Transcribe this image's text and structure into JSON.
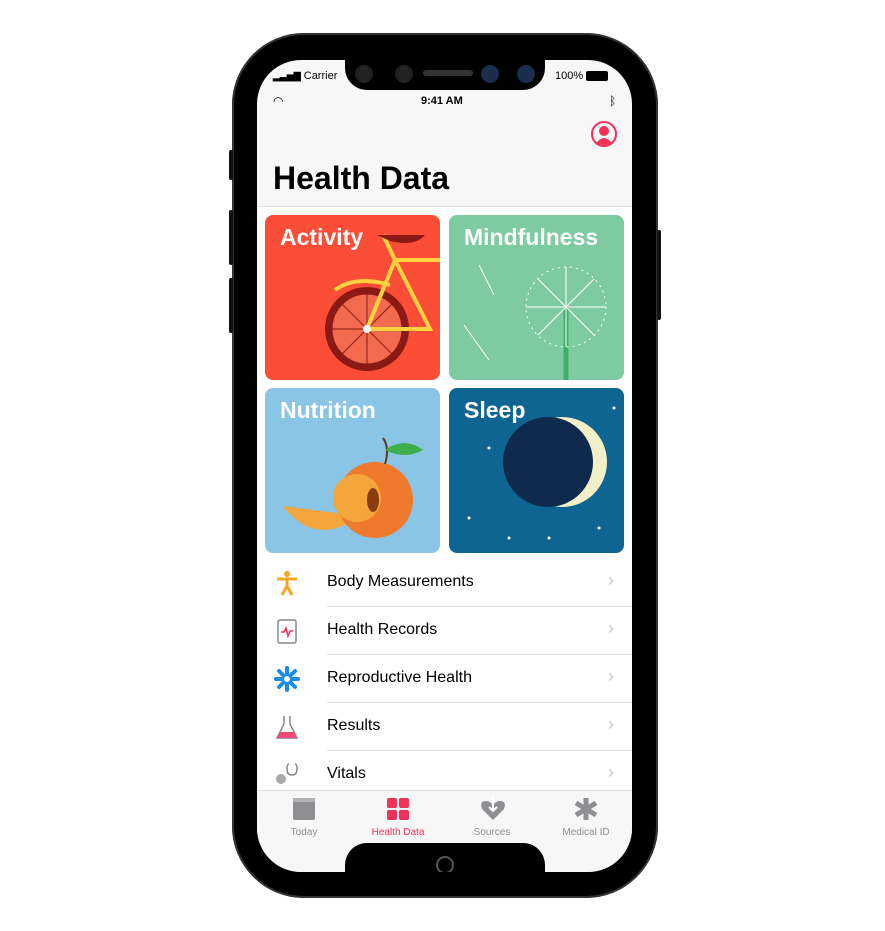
{
  "status_bar": {
    "carrier": "Carrier",
    "time": "9:41 AM",
    "battery": "100%"
  },
  "header": {
    "title": "Health Data",
    "profile_icon": "person-circle-icon"
  },
  "tiles": [
    {
      "label": "Activity",
      "color": "#fc4e37"
    },
    {
      "label": "Mindfulness",
      "color": "#7ecba1"
    },
    {
      "label": "Nutrition",
      "color": "#8ac5e6"
    },
    {
      "label": "Sleep",
      "color": "#0e6591"
    }
  ],
  "list": [
    {
      "label": "Body Measurements",
      "icon": "figure-icon"
    },
    {
      "label": "Health Records",
      "icon": "clipboard-icon"
    },
    {
      "label": "Reproductive Health",
      "icon": "snowflake-flower-icon"
    },
    {
      "label": "Results",
      "icon": "flask-icon"
    },
    {
      "label": "Vitals",
      "icon": "stethoscope-icon"
    }
  ],
  "tabs": [
    {
      "label": "Today",
      "active": false
    },
    {
      "label": "Health Data",
      "active": true
    },
    {
      "label": "Sources",
      "active": false
    },
    {
      "label": "Medical ID",
      "active": false
    }
  ],
  "accent": "#f2305a"
}
